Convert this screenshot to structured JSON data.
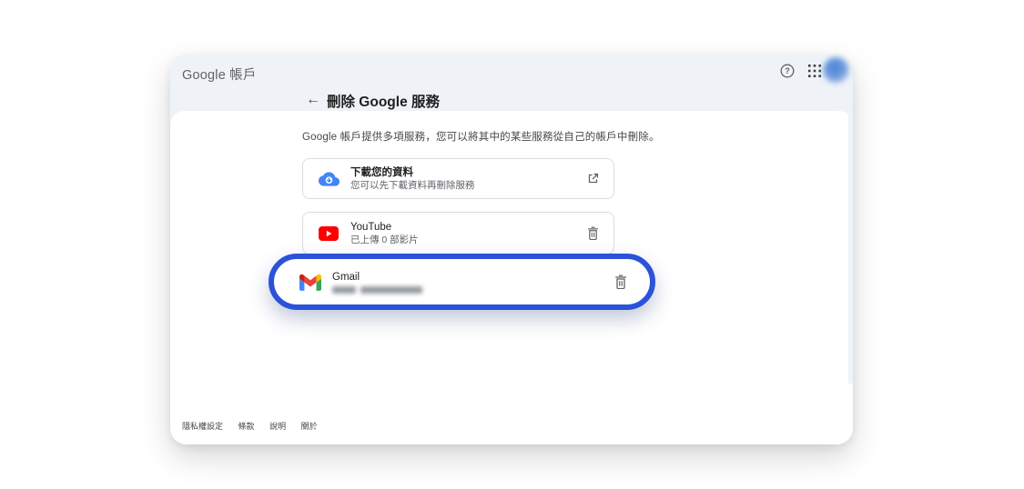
{
  "header": {
    "app_title": "Google 帳戶",
    "help_icon": "help-circle-icon",
    "apps_icon": "apps-grid-icon",
    "avatar": "user-avatar-blurred"
  },
  "page": {
    "back_arrow": "←",
    "title": "刪除 Google 服務",
    "intro": "Google 帳戶提供多項服務，您可以將其中的某些服務從自己的帳戶中刪除。"
  },
  "services": [
    {
      "name": "下載您的資料",
      "description": "您可以先下載資料再刪除服務",
      "icon": "cloud-download-icon",
      "action_icon": "external-link-icon"
    },
    {
      "name": "YouTube",
      "description": "已上傳 0 部影片",
      "icon": "youtube-icon",
      "action_icon": "trash-icon"
    },
    {
      "name": "Gmail",
      "description_redacted": true,
      "icon": "gmail-icon",
      "action_icon": "trash-icon",
      "highlighted": true
    }
  ],
  "footer": {
    "links": [
      "隱私權設定",
      "條款",
      "說明",
      "關於"
    ]
  },
  "colors": {
    "highlight_ring": "#2b52d9",
    "header_band": "#eff3f8",
    "card_border": "#dadce0",
    "youtube_red": "#ff0000",
    "takeout_blue": "#4285f4"
  }
}
